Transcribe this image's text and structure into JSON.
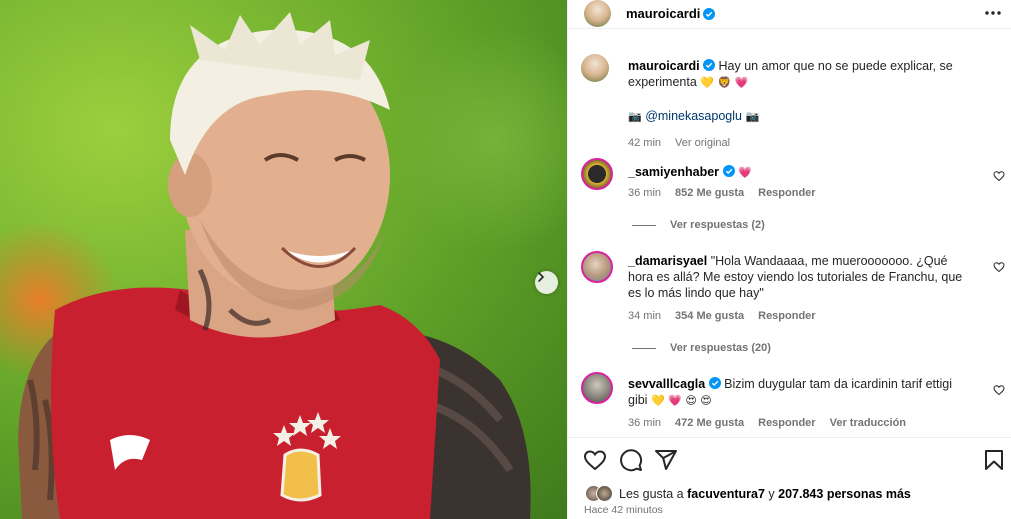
{
  "post": {
    "username": "mauroicardi",
    "verified": true,
    "caption": {
      "username": "mauroicardi",
      "text": "Hay un amor que no se puede explicar, se experimenta",
      "emojis": "💛 🦁 💗",
      "mention_prefix": "📷",
      "mention": "@minekasapoglu",
      "mention_suffix": "📷",
      "time": "42 min",
      "see_original": "Ver original"
    }
  },
  "comments": [
    {
      "username": "_samiyenhaber",
      "verified": true,
      "text": "",
      "emojis": "💗",
      "time": "36 min",
      "likes": "852 Me gusta",
      "reply": "Responder",
      "view_replies": "Ver respuestas (2)"
    },
    {
      "username": "_damarisyael",
      "verified": false,
      "text": "\"Hola Wandaaaa, me muerooooooo. ¿Qué hora es allá? Me estoy viendo los tutoriales de Franchu, que es lo más lindo que hay\"",
      "emojis": "",
      "time": "34 min",
      "likes": "354 Me gusta",
      "reply": "Responder",
      "view_replies": "Ver respuestas (20)"
    },
    {
      "username": "sevvalllcagla",
      "verified": true,
      "text": "Bizim duygular tam da icardinin tarif ettigi gibi",
      "emojis": "💛 💗 😍 😍",
      "time": "36 min",
      "likes": "472 Me gusta",
      "reply": "Responder",
      "translate": "Ver traducción"
    }
  ],
  "footer": {
    "likes_prefix": "Les gusta a",
    "likes_user": "facuventura7",
    "likes_connector": "y",
    "likes_count": "207.843 personas más",
    "time_ago": "Hace 42 minutos"
  },
  "icons": [
    "heart-icon",
    "comment-icon",
    "share-icon",
    "bookmark-icon",
    "more-icon",
    "verified-icon",
    "chevron-right-icon"
  ],
  "colors": {
    "verified": "#0095f6",
    "muted_text": "#737373",
    "mention": "#00376b",
    "jersey_red": "#c8202f",
    "background_green": "#6aa82c"
  }
}
